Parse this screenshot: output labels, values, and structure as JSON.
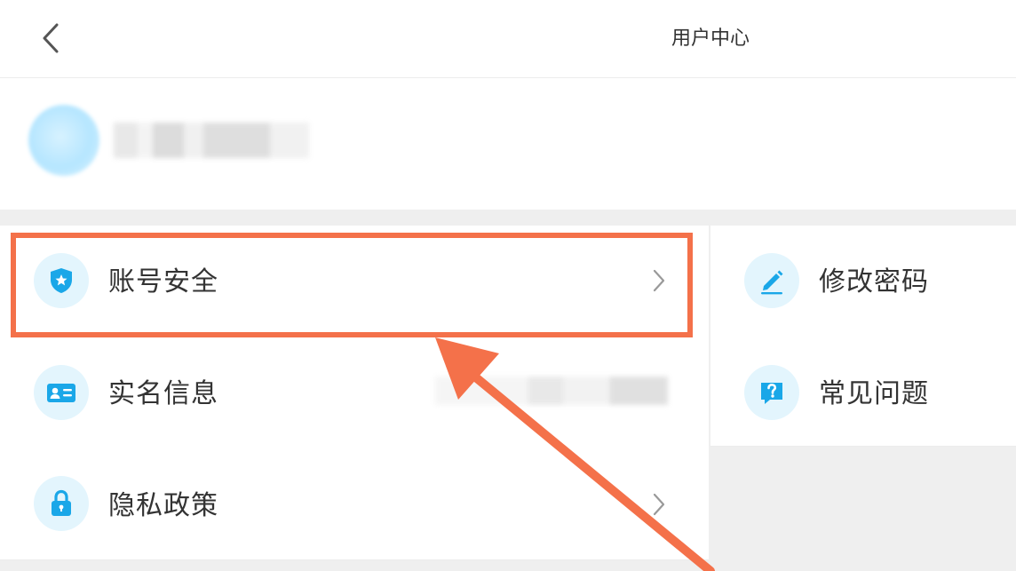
{
  "header": {
    "title": "用户中心",
    "back_icon": "chevron-left-icon"
  },
  "profile": {
    "avatar_icon": "avatar"
  },
  "menu": {
    "left": [
      {
        "label": "账号安全",
        "icon": "shield-icon"
      },
      {
        "label": "实名信息",
        "icon": "id-card-icon"
      },
      {
        "label": "隐私政策",
        "icon": "lock-icon"
      }
    ],
    "right": [
      {
        "label": "修改密码",
        "icon": "pencil-icon"
      },
      {
        "label": "常见问题",
        "icon": "question-icon"
      }
    ]
  },
  "colors": {
    "accent": "#1aa7e8",
    "icon_bg": "#e3f5fd",
    "annotation": "#f4714a",
    "background": "#efefef"
  }
}
